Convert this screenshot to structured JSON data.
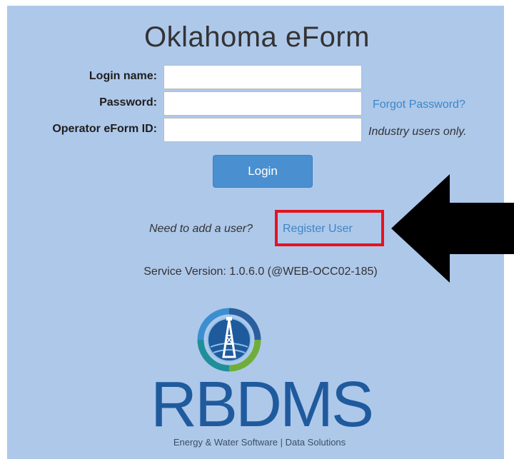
{
  "title": "Oklahoma eForm",
  "form": {
    "login_label": "Login name:",
    "login_value": "",
    "password_label": "Password:",
    "password_value": "",
    "operator_label": "Operator eForm ID:",
    "operator_value": "",
    "forgot_password": "Forgot Password?",
    "industry_note": "Industry users only.",
    "login_button": "Login"
  },
  "register": {
    "prompt": "Need to add a user?",
    "link": "Register User"
  },
  "service_version": "Service Version: 1.0.6.0 (@WEB-OCC02-185)",
  "logo": {
    "wordmark": "RBDMS",
    "tagline": "Energy & Water Software | Data Solutions",
    "icon": "oil-derrick-globe-icon"
  },
  "annotation": {
    "arrow_icon": "arrow-left-icon",
    "arrow_color": "#000000",
    "highlight_color": "#e5131f"
  },
  "colors": {
    "background": "#aec8ea",
    "link": "#3d86c6",
    "button": "#4a90d0",
    "brand": "#1f5a9d"
  }
}
